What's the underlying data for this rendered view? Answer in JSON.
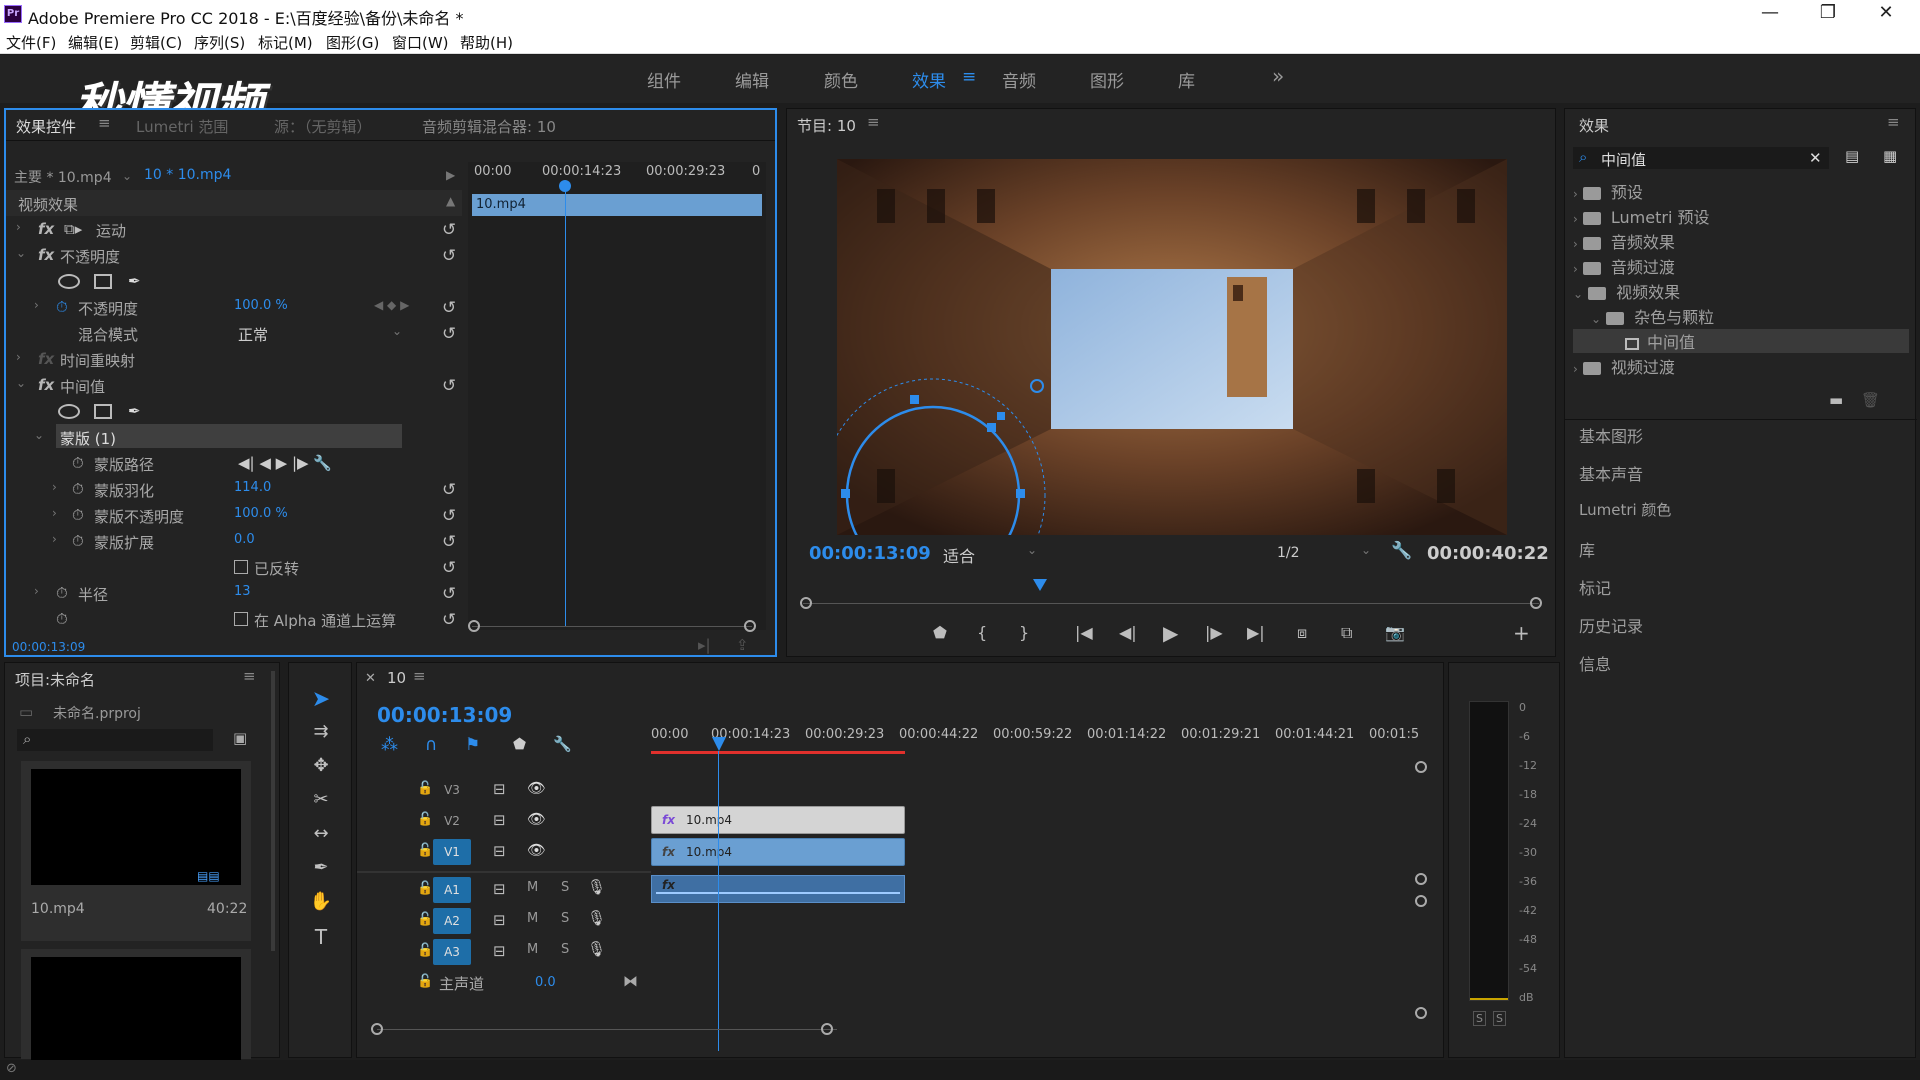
{
  "window": {
    "title": "Adobe Premiere Pro CC 2018 - E:\\百度经验\\备份\\未命名 *",
    "app_icon": "Pr"
  },
  "menu": [
    "文件(F)",
    "编辑(E)",
    "剪辑(C)",
    "序列(S)",
    "标记(M)",
    "图形(G)",
    "窗口(W)",
    "帮助(H)"
  ],
  "workspaces": [
    "组件",
    "编辑",
    "颜色",
    "效果",
    "音频",
    "图形",
    "库"
  ],
  "workspace_active": "效果",
  "watermark": "秒懂视频",
  "effect_controls": {
    "tabs": [
      "效果控件",
      "Lumetri 范围",
      "源：（无剪辑）",
      "音频剪辑混合器: 10"
    ],
    "master": "主要 * 10.mp4",
    "clip": "10 * 10.mp4",
    "section": "视频效果",
    "ruler": [
      "00:00",
      "00:00:14:23",
      "00:00:29:23",
      "0"
    ],
    "clip_label": "10.mp4",
    "rows": {
      "motion": "运动",
      "opacity": "不透明度",
      "opacity_prop": "不透明度",
      "opacity_val": "100.0 %",
      "blend": "混合模式",
      "blend_val": "正常",
      "remap": "时间重映射",
      "median": "中间值",
      "mask": "蒙版 (1)",
      "mask_path": "蒙版路径",
      "feather": "蒙版羽化",
      "feather_val": "114.0",
      "mask_opacity": "蒙版不透明度",
      "mask_opacity_val": "100.0 %",
      "expand": "蒙版扩展",
      "expand_val": "0.0",
      "inverted": "已反转",
      "radius": "半径",
      "radius_val": "13",
      "alpha": "在 Alpha 通道上运算"
    },
    "timecode": "00:00:13:09"
  },
  "program": {
    "title": "节目: 10",
    "timecode": "00:00:13:09",
    "fit": "适合",
    "resolution": "1/2",
    "duration": "00:00:40:22"
  },
  "effects_panel": {
    "title": "效果",
    "search": "中间值",
    "tree": [
      {
        "label": "预设",
        "depth": 0,
        "open": false
      },
      {
        "label": "Lumetri 预设",
        "depth": 0,
        "open": false
      },
      {
        "label": "音频效果",
        "depth": 0,
        "open": false
      },
      {
        "label": "音频过渡",
        "depth": 0,
        "open": false
      },
      {
        "label": "视频效果",
        "depth": 0,
        "open": true
      },
      {
        "label": "杂色与颗粒",
        "depth": 1,
        "open": true
      },
      {
        "label": "中间值",
        "depth": 2,
        "open": false,
        "selected": true
      },
      {
        "label": "视频过渡",
        "depth": 0,
        "open": false
      }
    ],
    "sections": [
      "基本图形",
      "基本声音",
      "Lumetri 颜色",
      "库",
      "标记",
      "历史记录",
      "信息"
    ]
  },
  "project": {
    "title": "项目:未命名",
    "file": "未命名.prproj",
    "item_name": "10.mp4",
    "item_duration": "40:22"
  },
  "timeline": {
    "tab": "10",
    "timecode": "00:00:13:09",
    "ruler": [
      "00:00",
      "00:00:14:23",
      "00:00:29:23",
      "00:00:44:22",
      "00:00:59:22",
      "00:01:14:22",
      "00:01:29:21",
      "00:01:44:21",
      "00:01:5"
    ],
    "video_tracks": [
      "V3",
      "V2",
      "V1"
    ],
    "audio_tracks": [
      "A1",
      "A2",
      "A3"
    ],
    "clip_v2": "10.mp4",
    "clip_v1": "10.mp4",
    "master": "主声道",
    "master_val": "0.0",
    "mute": "M",
    "solo": "S"
  },
  "meter": {
    "labels": [
      "0",
      "-6",
      "-12",
      "-18",
      "-24",
      "-30",
      "-36",
      "-42",
      "-48",
      "-54",
      "dB"
    ],
    "solo": "S"
  },
  "colors": {
    "accent": "#2d8ceb",
    "panel": "#232323",
    "bg": "#1d1d1d",
    "clip_v1": "#6a9fd2",
    "clip_v2": "#d0d0d0"
  }
}
